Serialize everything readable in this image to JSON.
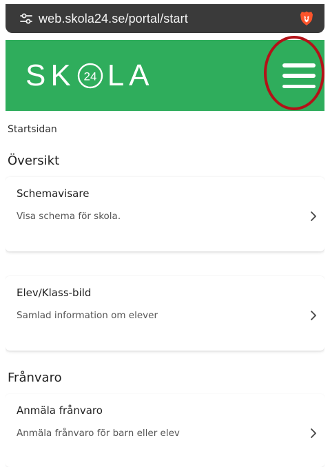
{
  "browser": {
    "url": "web.skola24.se/portal/start",
    "tune_icon": "tune-icon",
    "brave_icon": "brave-lion-icon"
  },
  "header": {
    "logo_left": "SK",
    "logo_badge": "24",
    "logo_right": "LA",
    "menu_icon": "hamburger-menu-icon",
    "brand_color": "#2fad5c",
    "highlight_color": "#b31218"
  },
  "breadcrumb": "Startsidan",
  "sections": [
    {
      "heading": "Översikt",
      "cards": [
        {
          "title": "Schemavisare",
          "description": "Visa schema för skola."
        },
        {
          "title": "Elev/Klass-bild",
          "description": "Samlad information om elever"
        }
      ]
    },
    {
      "heading": "Frånvaro",
      "cards": [
        {
          "title": "Anmäla frånvaro",
          "description": "Anmäla frånvaro för barn eller elev"
        }
      ]
    }
  ]
}
